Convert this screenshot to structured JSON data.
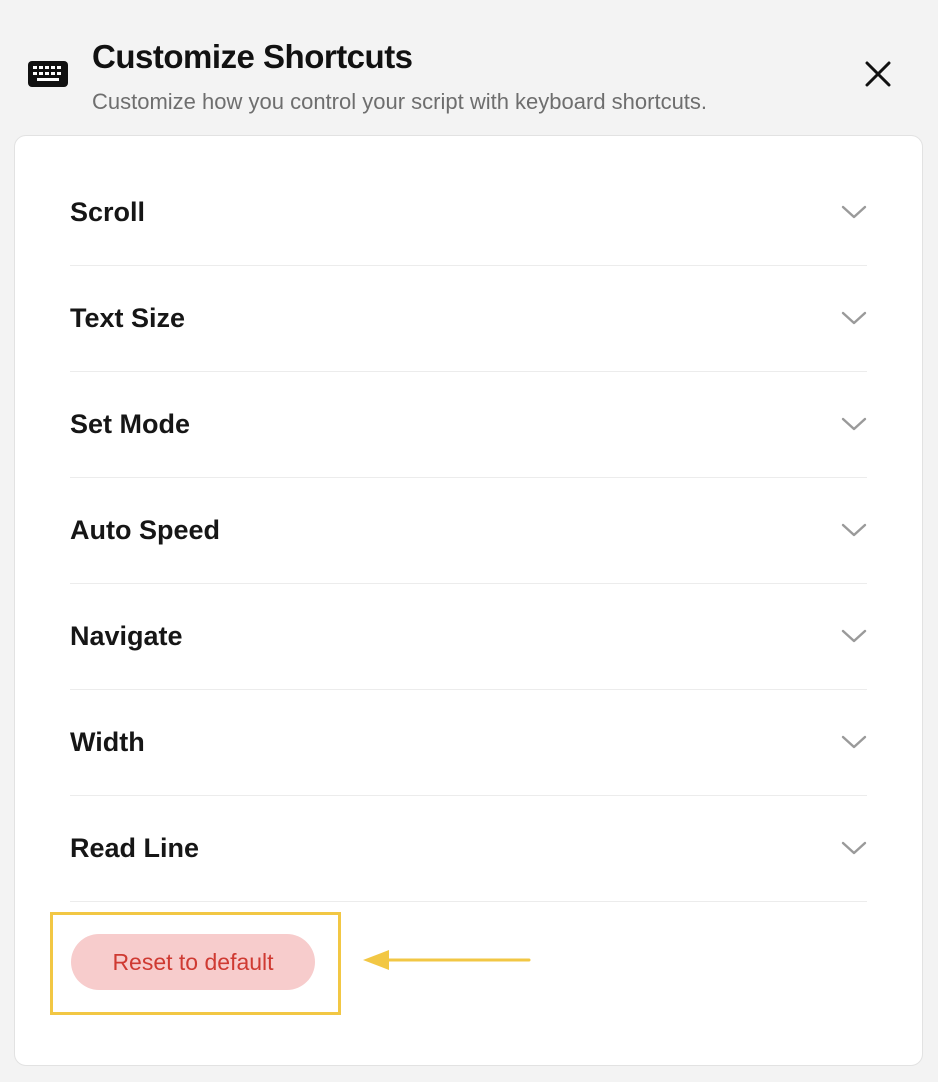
{
  "header": {
    "title": "Customize Shortcuts",
    "subtitle": "Customize how you control your script with keyboard shortcuts.",
    "icon": "keyboard-icon",
    "close_icon": "close-icon"
  },
  "shortcuts": {
    "items": [
      {
        "label": "Scroll",
        "icon": "chevron-down-icon"
      },
      {
        "label": "Text Size",
        "icon": "chevron-down-icon"
      },
      {
        "label": "Set Mode",
        "icon": "chevron-down-icon"
      },
      {
        "label": "Auto Speed",
        "icon": "chevron-down-icon"
      },
      {
        "label": "Navigate",
        "icon": "chevron-down-icon"
      },
      {
        "label": "Width",
        "icon": "chevron-down-icon"
      },
      {
        "label": "Read Line",
        "icon": "chevron-down-icon"
      }
    ]
  },
  "footer": {
    "reset_label": "Reset to default"
  },
  "colors": {
    "reset_bg": "#f7cccc",
    "reset_text": "#cf3a32",
    "highlight": "#f2c744",
    "chevron": "#9a9a9a"
  }
}
